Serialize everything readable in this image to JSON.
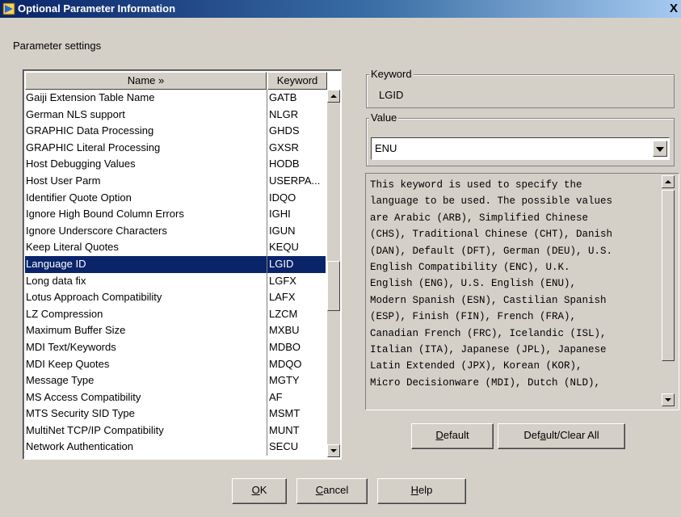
{
  "window": {
    "title": "Optional Parameter Information",
    "close_label": "X",
    "section_label": "Parameter settings"
  },
  "table": {
    "columns": [
      "Name »",
      "Keyword"
    ],
    "selected_index": 10,
    "rows": [
      {
        "name": "Gaiji Extension Table Name",
        "keyword": "GATB"
      },
      {
        "name": "German NLS support",
        "keyword": "NLGR"
      },
      {
        "name": "GRAPHIC Data Processing",
        "keyword": "GHDS"
      },
      {
        "name": "GRAPHIC Literal Processing",
        "keyword": "GXSR"
      },
      {
        "name": "Host Debugging Values",
        "keyword": "HODB"
      },
      {
        "name": "Host User Parm",
        "keyword": "USERPA..."
      },
      {
        "name": "Identifier Quote Option",
        "keyword": "IDQO"
      },
      {
        "name": "Ignore High Bound Column Errors",
        "keyword": "IGHI"
      },
      {
        "name": "Ignore Underscore Characters",
        "keyword": "IGUN"
      },
      {
        "name": "Keep Literal Quotes",
        "keyword": "KEQU"
      },
      {
        "name": "Language ID",
        "keyword": "LGID"
      },
      {
        "name": "Long data fix",
        "keyword": "LGFX"
      },
      {
        "name": "Lotus Approach Compatibility",
        "keyword": "LAFX"
      },
      {
        "name": "LZ Compression",
        "keyword": "LZCM"
      },
      {
        "name": "Maximum Buffer Size",
        "keyword": "MXBU"
      },
      {
        "name": "MDI Text/Keywords",
        "keyword": "MDBO"
      },
      {
        "name": "MDI Keep Quotes",
        "keyword": "MDQO"
      },
      {
        "name": "Message Type",
        "keyword": "MGTY"
      },
      {
        "name": "MS Access Compatibility",
        "keyword": "AF"
      },
      {
        "name": "MTS Security SID Type",
        "keyword": "MSMT"
      },
      {
        "name": "MultiNet TCP/IP Compatibility",
        "keyword": "MUNT"
      },
      {
        "name": "Network Authentication",
        "keyword": "SECU"
      }
    ]
  },
  "keyword_group": {
    "legend": "Keyword",
    "value": "LGID"
  },
  "value_group": {
    "legend": "Value",
    "selected": "ENU"
  },
  "description": "This keyword is used to specify the\nlanguage to be used. The possible values\nare Arabic (ARB), Simplified Chinese\n(CHS), Traditional Chinese (CHT), Danish\n(DAN), Default (DFT), German (DEU), U.S.\nEnglish Compatibility (ENC), U.K.\nEnglish (ENG), U.S. English (ENU),\nModern Spanish (ESN), Castilian Spanish\n(ESP), Finish (FIN), French (FRA),\nCanadian French (FRC), Icelandic (ISL),\nItalian (ITA), Japanese (JPL), Japanese\nLatin Extended (JPX), Korean (KOR),\nMicro Decisionware (MDI), Dutch (NLD),",
  "buttons": {
    "default": {
      "pre": "",
      "key": "D",
      "post": "efault"
    },
    "default_clear_all": {
      "pre": "Def",
      "key": "a",
      "post": "ult/Clear All"
    },
    "ok": {
      "pre": "",
      "key": "O",
      "post": "K"
    },
    "cancel": {
      "pre": "",
      "key": "C",
      "post": "ancel"
    },
    "help": {
      "pre": "",
      "key": "H",
      "post": "elp"
    }
  },
  "colors": {
    "selection": "#0a246a",
    "face": "#d4d0c8"
  }
}
